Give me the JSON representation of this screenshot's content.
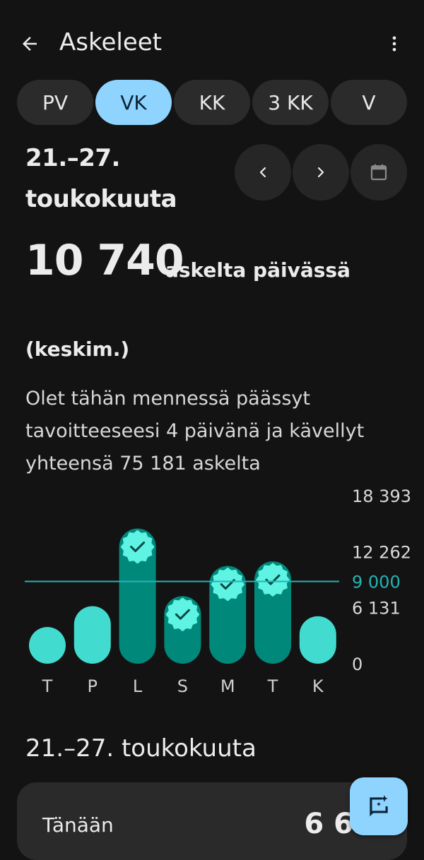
{
  "app": {
    "title": "Askeleet"
  },
  "tabs": [
    "PV",
    "VK",
    "KK",
    "3 KK",
    "V"
  ],
  "active_tab": "VK",
  "header": {
    "range_line1": "21.–27.",
    "range_line2": "toukokuuta"
  },
  "stats": {
    "average_steps": "10 740",
    "unit": "askelta päivässä",
    "avg_label": "(keskim.)"
  },
  "summary_text": "Olet tähän mennessä päässyt tavoitteeseesi 4 päivänä ja kävellyt yhteensä 75 181 askelta",
  "colors": {
    "bar_below_goal": "#41dccf",
    "bar_goal_met": "#00897b",
    "goal_line": "#26b3b3",
    "accent": "#8fd4ff",
    "badge": "#5ef3e3"
  },
  "chart_data": {
    "type": "bar",
    "categories": [
      "T",
      "P",
      "L",
      "S",
      "M",
      "T",
      "K"
    ],
    "values": [
      3900,
      6300,
      14800,
      7400,
      10700,
      11200,
      5200
    ],
    "goal": 9000,
    "goal_label": "9 000",
    "goal_met": [
      false,
      false,
      true,
      true,
      true,
      true,
      false
    ],
    "ylim": [
      0,
      18393
    ],
    "y_ticks": [
      0,
      6131,
      12262,
      18393
    ],
    "y_tick_labels": [
      "0",
      "6 131",
      "12 262",
      "18 393"
    ]
  },
  "week_section": {
    "title": "21.–27. toukokuuta"
  },
  "today_card": {
    "label": "Tänään",
    "value": "6 6…"
  },
  "icons": {
    "back": "arrow-left-icon",
    "more": "more-vert-icon",
    "prev": "chevron-left-icon",
    "next": "chevron-right-icon",
    "calendar": "calendar-icon",
    "fab": "ai-chat-icon"
  }
}
